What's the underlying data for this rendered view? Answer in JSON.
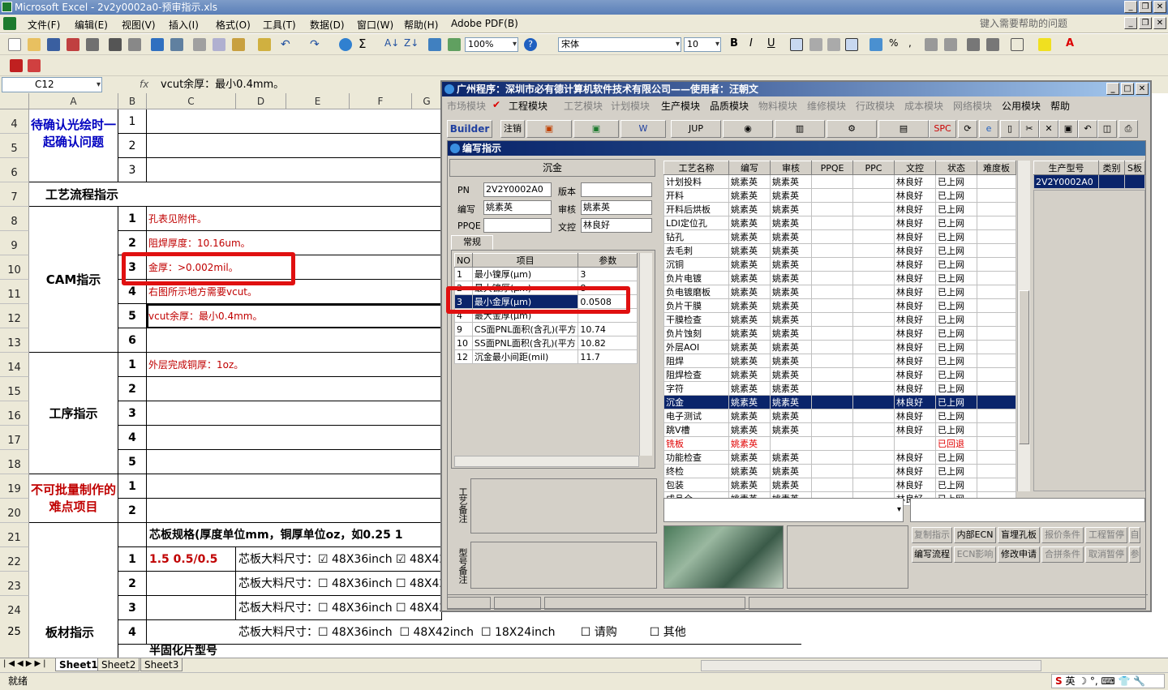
{
  "excel": {
    "title": "Microsoft Excel - 2v2y0002a0-预审指示.xls",
    "menu": [
      "文件(F)",
      "编辑(E)",
      "视图(V)",
      "插入(I)",
      "格式(O)",
      "工具(T)",
      "数据(D)",
      "窗口(W)",
      "帮助(H)",
      "Adobe PDF(B)"
    ],
    "help_placeholder": "键入需要帮助的问题",
    "zoom": "100%",
    "font": "宋体",
    "font_size": "10",
    "name_box": "C12",
    "formula": "vcut余厚：最小0.4mm。",
    "columns": [
      "A",
      "B",
      "C",
      "D",
      "E",
      "F",
      "G"
    ],
    "rows": [
      "4",
      "5",
      "6",
      "7",
      "8",
      "9",
      "10",
      "11",
      "12",
      "13",
      "14",
      "15",
      "16",
      "17",
      "18",
      "19",
      "20",
      "21",
      "22",
      "23",
      "24",
      "25"
    ],
    "cells": {
      "confirm_label": "待确认光绘时一起确认问题",
      "flow_label": "工艺流程指示",
      "cam_label": "CAM指示",
      "process_label": "工序指示",
      "difficulty_label": "不可批量制作的难点项目",
      "material_label": "板材指示",
      "cam_items": [
        "孔表见附件。",
        "阻焊厚度：10.16um。",
        "金厚：>0.002mil。",
        "右图所示地方需要vcut。",
        "vcut余厚：最小0.4mm。",
        ""
      ],
      "process_items": [
        "外层完成铜厚：1oz。",
        "",
        "",
        "",
        ""
      ],
      "core_header": "芯板规格(厚度单位mm，铜厚单位oz，如0.25 1",
      "core_spec_1": "1.5 0.5/0.5",
      "core_size_label": "芯板大料尺寸：",
      "size_options": [
        "48X36inch",
        "48X42inch",
        "18X24inch",
        "请购",
        "其他"
      ],
      "prepreg_label": "半固化片型号"
    },
    "sheets": [
      "Sheet1",
      "Sheet2",
      "Sheet3"
    ],
    "status": "就绪",
    "ime": "英"
  },
  "app": {
    "title": "广州程序：深圳市必有德计算机软件技术有限公司——使用者：汪朝文",
    "menu": [
      "市场模块",
      "工程模块",
      "工艺模块",
      "计划模块",
      "生产模块",
      "品质模块",
      "物料模块",
      "维修模块",
      "行政模块",
      "成本模块",
      "网络模块",
      "公用模块",
      "帮助"
    ],
    "toolbar": [
      "Builder",
      "注销",
      "JUP",
      "SPC"
    ],
    "dialog_title": "编写指示",
    "process": "沉金",
    "pn_label": "PN",
    "pn": "2V2Y0002A0",
    "version_label": "版本",
    "version": "",
    "writer_label": "编写",
    "writer": "姚素英",
    "reviewer_label": "审核",
    "reviewer": "姚素英",
    "ppqe_label": "PPQE",
    "ppqe": "",
    "doc_label": "文控",
    "doc": "林良好",
    "tab": "常规",
    "param_headers": [
      "NO",
      "项目",
      "参数"
    ],
    "params": [
      {
        "no": "1",
        "item": "最小镍厚(μm)",
        "val": "3"
      },
      {
        "no": "2",
        "item": "最大镍厚(μm)",
        "val": "8"
      },
      {
        "no": "3",
        "item": "最小金厚(μm)",
        "val": "0.0508"
      },
      {
        "no": "4",
        "item": "最大金厚(μm)",
        "val": ""
      },
      {
        "no": "9",
        "item": "CS面PNL面积(含孔)(平方",
        "val": "10.74"
      },
      {
        "no": "10",
        "item": "SS面PNL面积(含孔)(平方",
        "val": "10.82"
      },
      {
        "no": "12",
        "item": "沉金最小间距(mil)",
        "val": "11.7"
      }
    ],
    "memo1": "工艺备注",
    "memo2": "型号备注",
    "proc_headers": [
      "工艺名称",
      "编写",
      "审核",
      "PPQE",
      "PPC",
      "文控",
      "状态",
      "难度板"
    ],
    "procs": [
      [
        "计划投料",
        "姚素英",
        "姚素英",
        "",
        "",
        "林良好",
        "已上网"
      ],
      [
        "开料",
        "姚素英",
        "姚素英",
        "",
        "",
        "林良好",
        "已上网"
      ],
      [
        "开料后烘板",
        "姚素英",
        "姚素英",
        "",
        "",
        "林良好",
        "已上网"
      ],
      [
        "LDI定位孔",
        "姚素英",
        "姚素英",
        "",
        "",
        "林良好",
        "已上网"
      ],
      [
        "钻孔",
        "姚素英",
        "姚素英",
        "",
        "",
        "林良好",
        "已上网"
      ],
      [
        "去毛刺",
        "姚素英",
        "姚素英",
        "",
        "",
        "林良好",
        "已上网"
      ],
      [
        "沉铜",
        "姚素英",
        "姚素英",
        "",
        "",
        "林良好",
        "已上网"
      ],
      [
        "负片电镀",
        "姚素英",
        "姚素英",
        "",
        "",
        "林良好",
        "已上网"
      ],
      [
        "负电镀磨板",
        "姚素英",
        "姚素英",
        "",
        "",
        "林良好",
        "已上网"
      ],
      [
        "负片干膜",
        "姚素英",
        "姚素英",
        "",
        "",
        "林良好",
        "已上网"
      ],
      [
        "干膜检查",
        "姚素英",
        "姚素英",
        "",
        "",
        "林良好",
        "已上网"
      ],
      [
        "负片蚀刻",
        "姚素英",
        "姚素英",
        "",
        "",
        "林良好",
        "已上网"
      ],
      [
        "外层AOI",
        "姚素英",
        "姚素英",
        "",
        "",
        "林良好",
        "已上网"
      ],
      [
        "阻焊",
        "姚素英",
        "姚素英",
        "",
        "",
        "林良好",
        "已上网"
      ],
      [
        "阻焊检查",
        "姚素英",
        "姚素英",
        "",
        "",
        "林良好",
        "已上网"
      ],
      [
        "字符",
        "姚素英",
        "姚素英",
        "",
        "",
        "林良好",
        "已上网"
      ],
      [
        "沉金",
        "姚素英",
        "姚素英",
        "",
        "",
        "林良好",
        "已上网"
      ],
      [
        "电子测试",
        "姚素英",
        "姚素英",
        "",
        "",
        "林良好",
        "已上网"
      ],
      [
        "跳V槽",
        "姚素英",
        "姚素英",
        "",
        "",
        "林良好",
        "已上网"
      ],
      [
        "铣板",
        "姚素英",
        "",
        "",
        "",
        "",
        "已回退"
      ],
      [
        "功能检查",
        "姚素英",
        "姚素英",
        "",
        "",
        "林良好",
        "已上网"
      ],
      [
        "终检",
        "姚素英",
        "姚素英",
        "",
        "",
        "林良好",
        "已上网"
      ],
      [
        "包装",
        "姚素英",
        "姚素英",
        "",
        "",
        "林良好",
        "已上网"
      ],
      [
        "成品仓",
        "姚素英",
        "姚素英",
        "",
        "",
        "林良好",
        "已上网"
      ]
    ],
    "model_headers": [
      "生产型号",
      "类别",
      "S板"
    ],
    "model": "2V2Y0002A0",
    "buttons_row1": [
      "复制指示",
      "内部ECN",
      "盲埋孔板",
      "报价条件",
      "工程暂停",
      "自"
    ],
    "buttons_row2": [
      "编写流程",
      "ECN影响",
      "修改申请",
      "合拼条件",
      "取消暂停",
      "参"
    ]
  }
}
